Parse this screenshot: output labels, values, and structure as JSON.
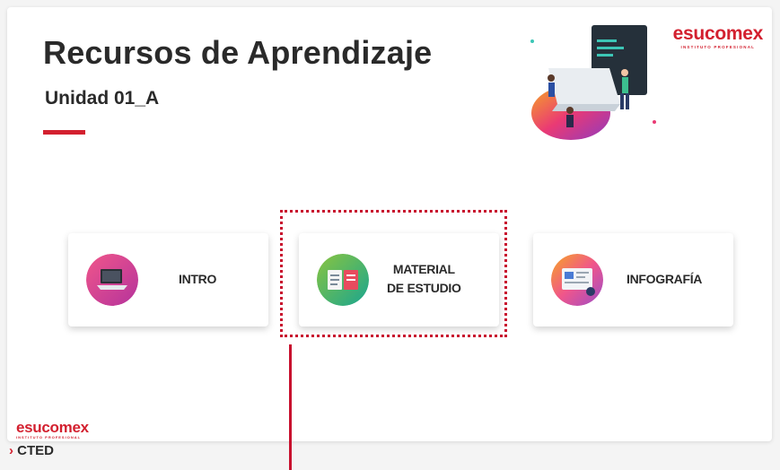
{
  "slide": {
    "title": "Recursos de Aprendizaje",
    "subtitle": "Unidad 01_A"
  },
  "brand": {
    "name": "esucomex",
    "tagline": "INSTITUTO PROFESIONAL",
    "color": "#d3202f"
  },
  "cards": [
    {
      "label": "INTRO",
      "icon": "laptop-icon",
      "icon_colors": [
        "#e9427c",
        "#b5339c"
      ]
    },
    {
      "label_lines": [
        "MATERIAL",
        "DE ESTUDIO"
      ],
      "icon": "book-icon",
      "icon_colors": [
        "#8ac43f",
        "#1aa68f"
      ]
    },
    {
      "label": "INFOGRAFÍA",
      "icon": "infographic-icon",
      "icon_colors": [
        "#f0568a",
        "#9c4cc9"
      ]
    }
  ],
  "footer": {
    "brand_name": "esucomex",
    "brand_tagline": "INSTITUTO PROFESIONAL",
    "cted_label": "CTED",
    "cted_chevron": "›"
  },
  "annotation": {
    "highlight_color": "#c8102e",
    "highlighted_card": "MATERIAL DE ESTUDIO"
  }
}
